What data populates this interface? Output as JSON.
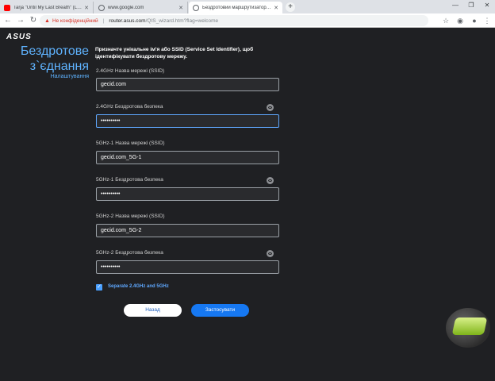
{
  "browser": {
    "tabs": [
      {
        "title": "Tarja \"Until My Last Breath\" (Live...",
        "favicon": "youtube-icon",
        "active": false
      },
      {
        "title": "www.google.com",
        "favicon": "globe-icon",
        "active": false
      },
      {
        "title": "Бездротовий маршрутизатор AS...",
        "favicon": "globe-icon",
        "active": true
      }
    ],
    "newtab_label": "+",
    "not_secure_label": "Не конфіденційний",
    "url_host": "router.asus.com",
    "url_path": "/QIS_wizard.htm?flag=welcome",
    "window_controls": [
      "—",
      "❐",
      "✕"
    ]
  },
  "page": {
    "logo": "ASUS",
    "side_title_line1": "Бездротове",
    "side_title_line2": "з`єднання",
    "side_subtitle": "Налаштування",
    "intro": "Призначте унікальне ім'я або SSID (Service Set Identifier), щоб ідентифікувати бездротову мережу.",
    "fields": [
      {
        "label": "2.4GHz Назва мережі (SSID)",
        "value": "gecid.com"
      },
      {
        "label": "2.4GHz Бездротова безпека",
        "value": "••••••••••"
      },
      {
        "label": "5GHz-1 Назва мережі (SSID)",
        "value": "gecid.com_5G-1"
      },
      {
        "label": "5GHz-1 Бездротова безпека",
        "value": "••••••••••"
      },
      {
        "label": "5GHz-2 Назва мережі (SSID)",
        "value": "gecid.com_5G-2"
      },
      {
        "label": "5GHz-2 Бездротова безпека",
        "value": "••••••••••"
      }
    ],
    "separate_label": "Separate 2.4GHz and 5GHz",
    "back_label": "Назад",
    "apply_label": "Застосувати"
  },
  "colors": {
    "accent": "#1678f2",
    "title_blue": "#5fb3ff",
    "background": "#1f2023",
    "warning": "#d93025"
  }
}
